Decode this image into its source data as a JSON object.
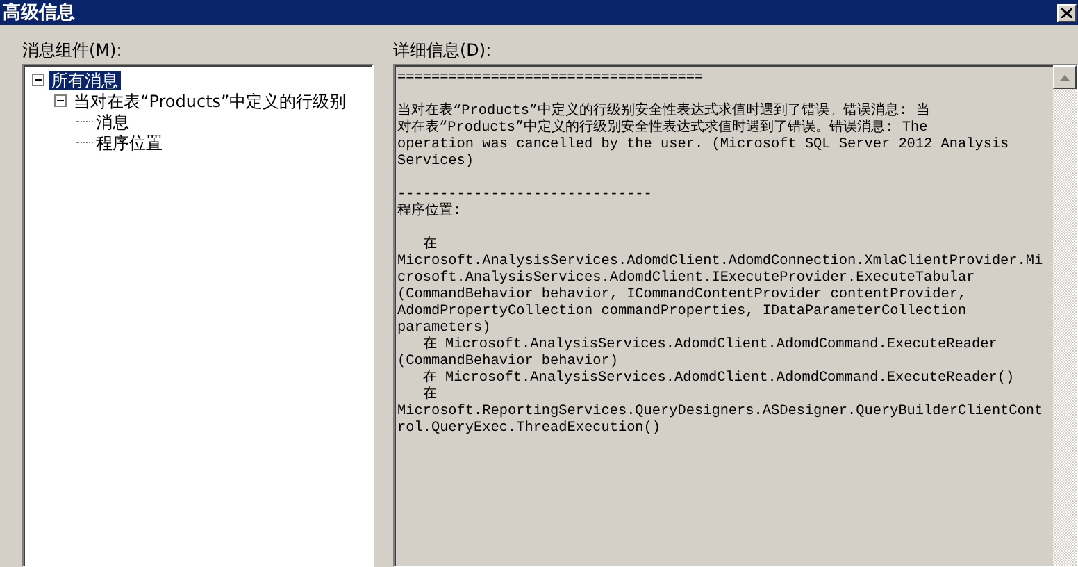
{
  "window": {
    "title": "高级信息"
  },
  "tree_panel": {
    "label": "消息组件(M):",
    "items": [
      {
        "label": "所有消息",
        "selected": true,
        "expanded": true,
        "children": [
          {
            "label": "当对在表“Products”中定义的行级别",
            "selected": false,
            "expanded": true,
            "children": [
              {
                "label": "消息",
                "selected": false
              },
              {
                "label": "程序位置",
                "selected": false
              }
            ]
          }
        ]
      }
    ]
  },
  "details_panel": {
    "label": "详细信息(D):",
    "blocks": [
      [
        "===================================="
      ],
      [
        "当对在表“Products”中定义的行级别安全性表达式求值时遇到了错误。错误消息: 当",
        "对在表“Products”中定义的行级别安全性表达式求值时遇到了错误。错误消息: The",
        "operation was cancelled by the user. (Microsoft SQL Server 2012 Analysis",
        "Services)"
      ],
      [
        "------------------------------",
        "程序位置:"
      ],
      [
        "   在",
        "Microsoft.AnalysisServices.AdomdClient.AdomdConnection.XmlaClientProvider.Mi",
        "crosoft.AnalysisServices.AdomdClient.IExecuteProvider.ExecuteTabular",
        "(CommandBehavior behavior, ICommandContentProvider contentProvider,",
        "AdomdPropertyCollection commandProperties, IDataParameterCollection",
        "parameters)",
        "   在 Microsoft.AnalysisServices.AdomdClient.AdomdCommand.ExecuteReader",
        "(CommandBehavior behavior)",
        "   在 Microsoft.AnalysisServices.AdomdClient.AdomdCommand.ExecuteReader()",
        "   在",
        "Microsoft.ReportingServices.QueryDesigners.ASDesigner.QueryBuilderClientCont",
        "rol.QueryExec.ThreadExecution()"
      ]
    ]
  }
}
